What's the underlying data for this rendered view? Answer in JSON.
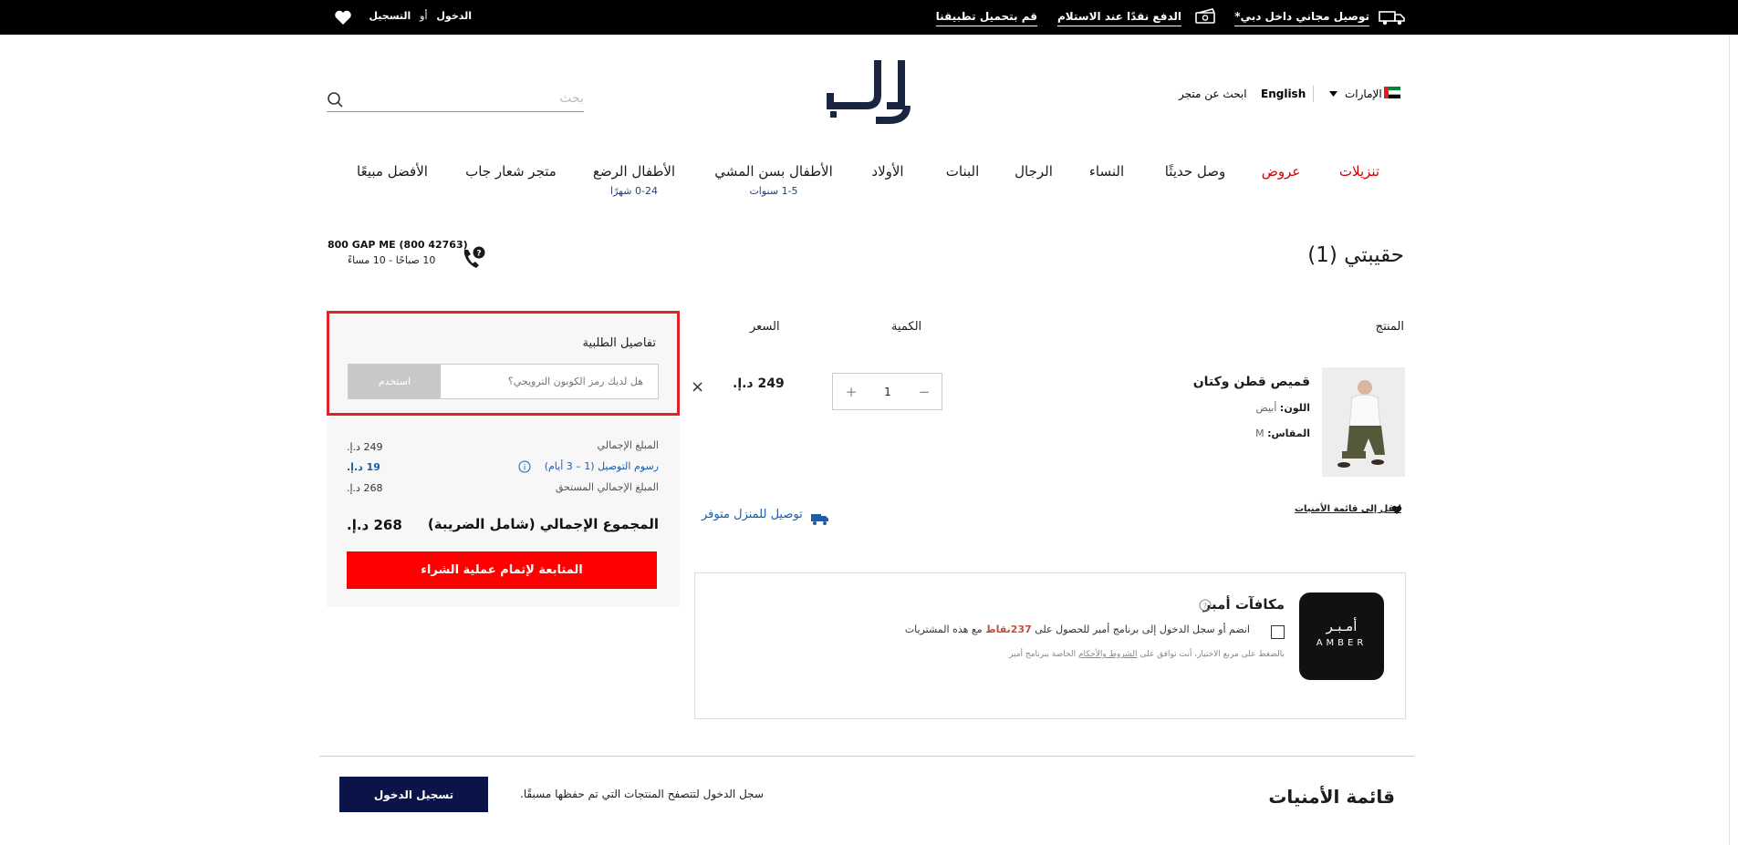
{
  "topbar": {
    "free_delivery": "توصيل مجاني داخل دبي*",
    "cod": "الدفع نقدًا عند الاستلام",
    "app": "قم بتحميل تطبيقنا",
    "login": "الدخول",
    "or": "أو",
    "register": "التسجيل"
  },
  "header": {
    "country": "الإمارات",
    "language": "English",
    "store_finder": "ابحث عن متجر",
    "logo": "جاب",
    "search_placeholder": "بحث"
  },
  "nav": [
    {
      "label": "تنزيلات",
      "sub": "",
      "red": true
    },
    {
      "label": "عروض",
      "sub": "",
      "red": true
    },
    {
      "label": "وصل حديثًا",
      "sub": ""
    },
    {
      "label": "النساء",
      "sub": ""
    },
    {
      "label": "الرجال",
      "sub": ""
    },
    {
      "label": "البنات",
      "sub": ""
    },
    {
      "label": "الأولاد",
      "sub": ""
    },
    {
      "label": "الأطفال بسن المشي",
      "sub": "1-5 سنوات"
    },
    {
      "label": "الأطفال الرضع",
      "sub": "0-24 شهرًا"
    },
    {
      "label": "متجر شعار جاب",
      "sub": ""
    },
    {
      "label": "الأفضل مبيعًا",
      "sub": ""
    }
  ],
  "cart": {
    "title": "حقيبتي (1)",
    "support_phone": "800 GAP ME (800 42763)",
    "support_hours": "10 صباحًا - 10 مساءً",
    "col_product": "المنتج",
    "col_quantity": "الكمية",
    "col_price": "السعر",
    "item": {
      "name": "قميص قطن وكتان",
      "color_label": "اللون:",
      "color_value": "أبيض",
      "size_label": "المقاس:",
      "size_value": "M",
      "quantity": "1",
      "minus": "−",
      "plus": "+",
      "price": "249 د.إ.",
      "remove": "×",
      "wishlist_link": "انقل إلى قائمة الأمنيات",
      "delivery": "توصيل للمنزل متوفر"
    }
  },
  "order": {
    "title": "تفاصيل الطلبية",
    "coupon_placeholder": "هل لديك رمز الكوبون الترويجي؟",
    "apply": "استخدم",
    "subtotal_label": "المبلغ الإجمالي",
    "subtotal": "249 د.إ.",
    "shipping_label": "رسوم التوصيل (1 – 3 أيام)",
    "shipping": "19 د.إ.",
    "due_label": "المبلغ الإجمالي المستحق",
    "due": "268 د.إ.",
    "total_label": "المجموع الإجمالي (شامل الضريبة)",
    "total": "268 د.إ.",
    "checkout": "المتابعة لإتمام عملية الشراء"
  },
  "amber": {
    "title": "مكافآت أمبر",
    "join_text_1": "انضم أو سجل الدخول إلى برنامج أمبر للحصول على",
    "points": "237نقاط",
    "join_text_2": "مع هذه المشتريات",
    "terms_1": "بالضغط على مربع الاختيار، أنت توافق على",
    "terms_link": "الشروط والأحكام",
    "terms_2": "الخاصة ببرنامج أمبر",
    "logo_ar": "أمـبـر",
    "logo_en": "AMBER"
  },
  "wishlist": {
    "title": "قائمة الأمنيات",
    "prompt": "سجل الدخول لتتصفح المنتجات التي تم حفظها مسبقًا.",
    "login_button": "تسجيل الدخول"
  },
  "colors": {
    "accent_red": "#ff0000",
    "highlight": "#e0222b",
    "navy": "#0b1446",
    "points": "#c0503a"
  }
}
